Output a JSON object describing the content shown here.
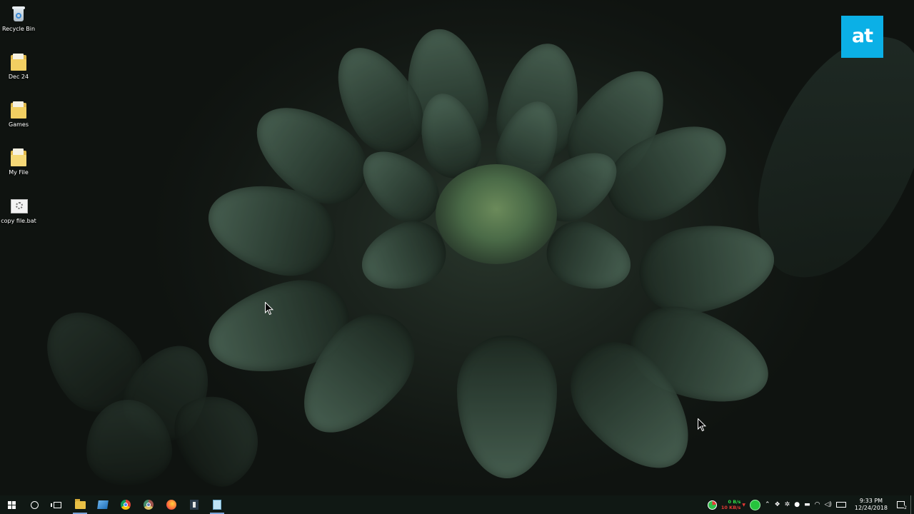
{
  "desktop": {
    "icons": [
      {
        "label": "Recycle Bin",
        "icon": "recycle-bin-icon"
      },
      {
        "label": "Dec 24",
        "icon": "folder-icon"
      },
      {
        "label": "Games",
        "icon": "folder-icon"
      },
      {
        "label": "My File",
        "icon": "folder-icon"
      },
      {
        "label": "copy file.bat",
        "icon": "batch-file-icon"
      }
    ]
  },
  "brand_badge": {
    "text": "at",
    "color": "#0bb0e6"
  },
  "taskbar": {
    "pinned": [
      {
        "name": "start-button",
        "icon": "windows-logo-icon"
      },
      {
        "name": "cortana-search-button",
        "icon": "cortana-circle-icon"
      },
      {
        "name": "task-view-button",
        "icon": "task-view-icon"
      },
      {
        "name": "file-explorer-button",
        "icon": "folder-icon",
        "active": true
      },
      {
        "name": "app-button",
        "icon": "blue-app-icon"
      },
      {
        "name": "chrome-button",
        "icon": "chrome-icon"
      },
      {
        "name": "chrome-profile-button",
        "icon": "chrome-icon"
      },
      {
        "name": "firefox-button",
        "icon": "firefox-icon"
      },
      {
        "name": "inkscape-button",
        "icon": "ink-app-icon"
      },
      {
        "name": "notepad-button",
        "icon": "notepad-icon"
      }
    ],
    "tray": {
      "upload_speed": "0 B/s",
      "download_speed": "10 KB/s",
      "time": "9:33 PM",
      "date": "12/24/2018",
      "notification_count": "2"
    }
  },
  "colors": {
    "taskbar": "#101814",
    "accent": "#7aa4d8"
  }
}
